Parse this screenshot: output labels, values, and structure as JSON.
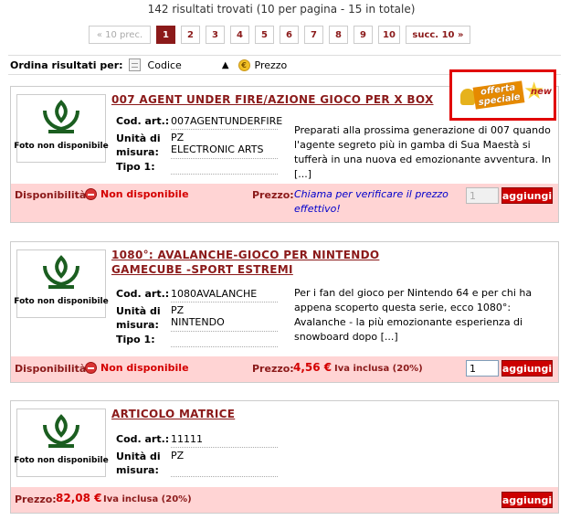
{
  "summary": "142 risultati trovati (10 per pagina - 15 in totale)",
  "pager": {
    "prev": "« 10 prec.",
    "pages": [
      "1",
      "2",
      "3",
      "4",
      "5",
      "6",
      "7",
      "8",
      "9",
      "10"
    ],
    "active": "1",
    "next": "succ. 10 »"
  },
  "sort": {
    "label": "Ordina risultati per:",
    "codice": "Codice",
    "prezzo": "Prezzo",
    "prezzo_icon": "€"
  },
  "labels": {
    "no_photo": "Foto non disponibile",
    "cod_art": "Cod. art.:",
    "unita": "Unità di misura:",
    "tipo": "Tipo 1:",
    "disponibilita": "Disponibilità:",
    "prezzo": "Prezzo:",
    "add_button": "aggiungi"
  },
  "products": [
    {
      "title": "007 AGENT UNDER FIRE/AZIONE GIOCO PER X BOX",
      "code": "007AGENTUNDERFIRE",
      "unit": "PZ",
      "brand": "ELECTRONIC ARTS",
      "tipo": "",
      "description": "Preparati alla prossima generazione di 007 quando l'agente segreto più in gamba di Sua Maestà si tufferà in una nuova ed emozionante avventura. In [...]",
      "availability": "Non disponibile",
      "price_note": "Chiama per verificare il prezzo effettivo!",
      "qty": "1",
      "badge": {
        "text": "offerta speciale",
        "new": "new"
      }
    },
    {
      "title": "1080°: AVALANCHE-GIOCO PER NINTENDO GAMECUBE -SPORT ESTREMI",
      "code": "1080AVALANCHE",
      "unit": "PZ",
      "brand": "NINTENDO",
      "tipo": "",
      "description": "Per i fan del gioco per Nintendo 64 e per chi ha appena scoperto questa serie, ecco 1080°: Avalanche - la più emozionante esperienza di snowboard dopo [...]",
      "availability": "Non disponibile",
      "price": "4,56 €",
      "vat": "Iva inclusa (20%)",
      "qty": "1"
    },
    {
      "title": "ARTICOLO MATRICE",
      "code": "11111",
      "unit": "PZ",
      "price": "82,08 €",
      "vat": "Iva inclusa (20%)"
    }
  ],
  "colors": {
    "brand": "#8b1a1a",
    "bar_bg": "#ffd4d4",
    "button": "#cc0000",
    "badge_border": "#e10000"
  }
}
